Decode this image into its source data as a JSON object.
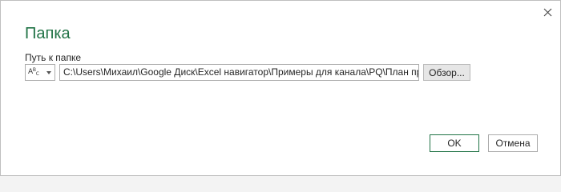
{
  "dialog": {
    "title": "Папка",
    "close_icon": "close-icon"
  },
  "folder_path": {
    "label": "Путь к папке",
    "type_selector": {
      "icon": "abc-text-type-icon",
      "glyph_a": "A",
      "glyph_b": "B",
      "glyph_c": "C"
    },
    "value": "C:\\Users\\Михаил\\Google Диск\\Excel навигатор\\Примеры для канала\\PQ\\План пр",
    "browse_label": "Обзор..."
  },
  "footer": {
    "ok_label": "OK",
    "cancel_label": "Отмена"
  },
  "colors": {
    "accent": "#217346",
    "text": "#262626",
    "border": "#ababab",
    "button_gray": "#e6e6e6"
  }
}
